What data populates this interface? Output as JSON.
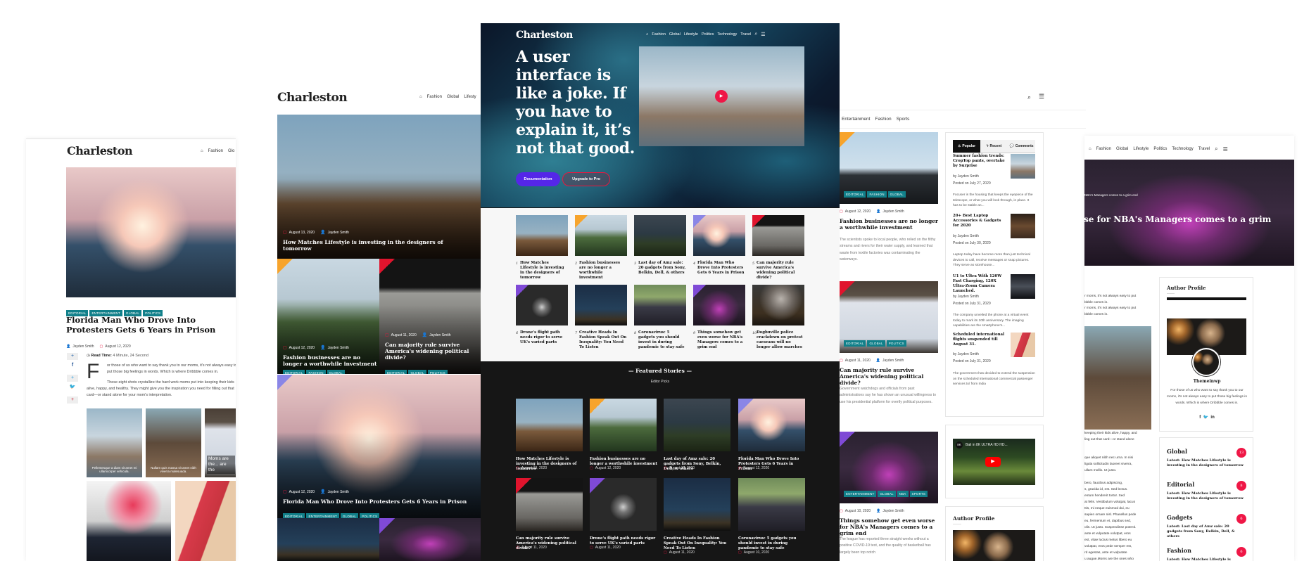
{
  "brand": "Charleston",
  "colors": {
    "accent_red": "#e8173f",
    "tag_teal": "#11808a",
    "doc_purple": "#5526e8",
    "dark_bg": "#161616"
  },
  "nav": {
    "home_icon": "home-icon",
    "items": [
      "Fashion",
      "Global",
      "Lifestyle",
      "Politics",
      "Technology",
      "Travel"
    ],
    "search_icon": "search-icon",
    "menu_icon": "hamburger-menu-icon"
  },
  "single_post": {
    "nav_items": [
      "Fashion",
      "Glo"
    ],
    "tags": [
      "Editorial",
      "Entertainment",
      "Global",
      "Politics"
    ],
    "title": "Florida Man Who Drove Into Protesters Gets 6 Years in Prison",
    "author": "Jayden Smith",
    "date": "August 12, 2020",
    "read_time_label": "Read Time:",
    "read_time": "4 Minute, 24 Second",
    "drop_cap": "F",
    "para1": "or those of us who want to say thank you to our moms, it's not always easy to put those big feelings in words. Which is where Dribbble comes in.",
    "para2": "These eight shots crystallize the hard work moms put into keeping their kids alive, happy, and healthy. They might give you the inspiration you need for filling out that card—or stand alone for your mom's interpretation.",
    "share_icons": [
      "facebook-icon",
      "twitter-icon",
      "pinterest-icon"
    ],
    "gallery_captions": [
      "Pellentesque a diam sit amet mi ullamcorper vehicula.",
      "Nullam quis massa sit amet nibh viverra malesuada.",
      "Moms are the... are the"
    ]
  },
  "mosaic": {
    "nav_items": [
      "Fashion",
      "Global",
      "Lifesty"
    ],
    "posts": [
      {
        "date": "August 13, 2020",
        "author": "Jayden Smith",
        "title": "How Matches Lifestyle is investing in the designers of tomorrow",
        "tags": [
          "Editorial",
          "Fashion",
          "Global"
        ]
      },
      {
        "date": "August 12, 2020",
        "author": "Jayden Smith",
        "title": "Fashion businesses are no longer a worthwhile investment",
        "tags": [
          "Editorial",
          "Fashion",
          "Global"
        ]
      },
      {
        "date": "August 11, 2020",
        "author": "Jayden Smith",
        "title": "Can majority rule survive America's widening political divide?",
        "tags": [
          "Editorial",
          "Global",
          "Politics"
        ]
      },
      {
        "date": "August 12, 2020",
        "author": "Jayden Smith",
        "title": "Florida Man Who Drove Into Protesters Gets 6 Years in Prison",
        "tags": [
          "Editorial",
          "Entertainment",
          "Global",
          "Politics"
        ]
      }
    ]
  },
  "home": {
    "headline": "A user interface is like a joke. If you have to explain it, it’s not that good.",
    "doc_button": "Documentation",
    "pro_button": "Upgrade to Pro",
    "top_list": [
      {
        "n": "1",
        "title": "How Matches Lifestyle is investing in the designers of tomorrow"
      },
      {
        "n": "2",
        "title": "Fashion businesses are no longer a worthwhile investment"
      },
      {
        "n": "3",
        "title": "Last day of Amz sale: 20 gadgets from Sony, Belkin, Dell, & others"
      },
      {
        "n": "4",
        "title": "Florida Man Who Drove Into Protesters Gets 6 Years in Prison"
      },
      {
        "n": "5",
        "title": "Can majority rule survive America's widening political divide?"
      },
      {
        "n": "6",
        "title": "Drone's flight path needs rigor to serve UK's varied parts"
      },
      {
        "n": "7",
        "title": "Creative Heads In Fashion Speak Out On Inequality: You Need To Listen"
      },
      {
        "n": "8",
        "title": "Coronavirus: 5 gadgets you should invest in during pandemic to stay safe"
      },
      {
        "n": "9",
        "title": "Things somehow get even worse for NBA's Managers comes to a grim end"
      },
      {
        "n": "10",
        "title": "Dogbuville police crackdown on protest caravans will no longer allow marches"
      }
    ],
    "featured_title": "Featured Stories",
    "featured_sub": "Editor Picks",
    "featured": [
      {
        "title": "How Matches Lifestyle is investing in the designers of tomorrow",
        "date": "August 13, 2020"
      },
      {
        "title": "Fashion businesses are no longer a worthwhile investment",
        "date": "August 12, 2020"
      },
      {
        "title": "Last day of Amz sale: 20 gadgets from Sony, Belkin, Dell, & others",
        "date": "August 12, 2020"
      },
      {
        "title": "Florida Man Who Drove Into Protesters Gets 6 Years in Prison",
        "date": "August 12, 2020"
      },
      {
        "title": "Can majority rule survive America's widening political divide?",
        "date": "August 11, 2020"
      },
      {
        "title": "Drone's flight path needs rigor to serve UK's varied parts",
        "date": "August 11, 2020"
      },
      {
        "title": "Creative Heads In Fashion Speak Out On Inequality: You Need To Listen",
        "date": "August 11, 2020"
      },
      {
        "title": "Coronavirus: 5 gadgets you should invest in during pandemic to stay safe",
        "date": "August 10, 2020"
      }
    ]
  },
  "archive": {
    "subnav": [
      "Entertainment",
      "Fashion",
      "Sports"
    ],
    "posts": [
      {
        "tags": [
          "Editorial",
          "Fashion",
          "Global"
        ],
        "date": "August 12, 2020",
        "author": "Jayden Smith",
        "title": "Fashion businesses are no longer a worthwhile investment",
        "excerpt": "The scientists spoke to local people, who relied on the filthy streams and rivers for their water supply, and learned that waste from textile factories was contaminating the waterways."
      },
      {
        "tags": [
          "Editorial",
          "Global",
          "Politics"
        ],
        "date": "August 11, 2020",
        "author": "Jayden Smith",
        "title": "Can majority rule survive America's widening political divide?",
        "excerpt": "Government watchdogs and officials from past administrations say he has shown an unusual willingness to use his presidential platform for overtly political purposes."
      },
      {
        "tags": [
          "Entertainment",
          "Global",
          "NBA",
          "Sports"
        ],
        "date": "August 10, 2020",
        "author": "Jayden Smith",
        "title": "Things somehow get even worse for NBA's Managers comes to a grim end",
        "excerpt": "The league has reported three straight weeks without a positive COVID-19 test, and the quality of basketball has largely been top notch"
      }
    ],
    "tabs": [
      "Popular",
      "Recent",
      "Comments"
    ],
    "sidebar_posts": [
      {
        "title": "Summer fashion trends: CropTop pants, overtake by Surprise",
        "by": "by Jayden Smith",
        "posted": "Posted on July 27, 2020",
        "excerpt": "Focuser is the housing that keeps the eyepiece of the telescope, or what you will look through, in place. It has to be stable an..."
      },
      {
        "title": "20+ Best Laptop Accessories & Gadgets for 2020",
        "by": "by Jayden Smith",
        "posted": "Posted on July 30, 2020",
        "excerpt": "Laptop today have become more than just technical devices to call, receive messages or snap pictures. They serve as storehouse..."
      },
      {
        "title": "U1 to Ultra With 120W Fast Charging, 120X Ultra-Zoom Camera Launched.",
        "by": "by Jayden Smith",
        "posted": "Posted on July 31, 2020",
        "excerpt": "The company unveiled the phone at a virtual event today to mark its 10th anniversary. The imaging capabilities are the smartphone's..."
      },
      {
        "title": "Scheduled international flights suspended till August 31.",
        "by": "by Jayden Smith",
        "posted": "Posted on July 31, 2020",
        "excerpt": "The government has decided to extend the suspension on the scheduled international commercial passenger services to/ from India"
      }
    ],
    "video_title": "Bali in 8K ULTRA HD HD...",
    "video_channel": "8K",
    "author_heading": "Author Profile"
  },
  "single2": {
    "hero_small": "NBA's Managers comes to a grim end",
    "hero_title": "se for NBA's Managers comes to a grim",
    "text_lines_a": [
      "r moms, it's not always easy to put",
      "bbble comes in.",
      "r moms, it's not always easy to put",
      "bbble comes in."
    ],
    "text_lines_b": [
      "keeping their kids alive, happy, and",
      "ling out that card—or stand alone"
    ],
    "text_lines_c": [
      "que aliquet nibh nec urna. In nisi",
      "ligula sollicitudin laoreet viverra,",
      "ullam mollis. Ut justo.",
      "",
      "bero, faucibus adipiscing,",
      "s, gravida id, est. Sed lectus.",
      "entum hendrerit tortor. Sed",
      "at felis. Vestibulum volutpat, lacus",
      "ttis, mi neque euismod dui, eu",
      "sapien ornare nisl. Phasellus pede",
      "eu, fermentum et, dapibus sed,",
      "olis. Ut justo. Suspendisse potenti.",
      "ante et vulputate volutpat, eros",
      "est, vitae luctus metus libero eu",
      "volutpat, eros pede semper est,",
      "rd egestas, ante et vulputate",
      "u augue.Moms are the ones who"
    ],
    "author_heading": "Author Profile",
    "author_name": "Themeinwp",
    "author_bio": "For those of us who want to say thank you to our moms, it's not always easy to put those big feelings in words. Which is where Dribbble comes in.",
    "author_social": [
      "facebook-icon",
      "twitter-icon",
      "linkedin-icon"
    ],
    "categories": [
      {
        "name": "Global",
        "count": "13",
        "latest": "Latest: How Matches Lifestyle is investing in the designers of tomorrow"
      },
      {
        "name": "Editorial",
        "count": "8",
        "latest": "Latest: How Matches Lifestyle is investing in the designers of tomorrow"
      },
      {
        "name": "Gadgets",
        "count": "6",
        "latest": "Latest: Last day of Amz sale: 20 gadgets from Sony, Belkin, Dell, & others"
      },
      {
        "name": "Fashion",
        "count": "6",
        "latest": "Latest: How Matches Lifestyle is"
      }
    ]
  }
}
